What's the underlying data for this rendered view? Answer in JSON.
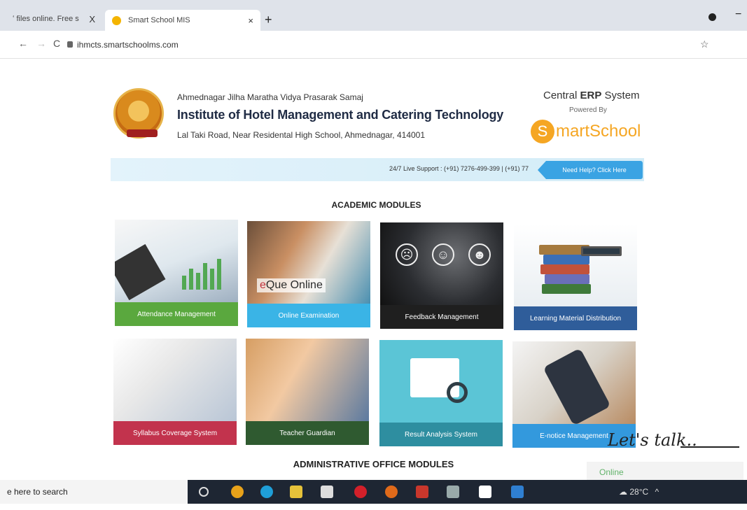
{
  "browser": {
    "tabs": [
      {
        "label": "ʻ files online. Free s",
        "close": "X"
      },
      {
        "label": "Smart School MIS",
        "close": "×"
      }
    ],
    "new_tab": "+",
    "url": "ihmcts.smartschoolms.com",
    "star": "☆"
  },
  "header": {
    "org": "Ahmednagar Jilha Maratha Vidya Prasarak Samaj",
    "institute": "Institute of Hotel Management and Catering Technology",
    "address": "Lal Taki Road, Near Residental High School, Ahmednagar, 414001",
    "erp_prefix": "Central ",
    "erp_bold": "ERP",
    "erp_suffix": " System",
    "powered_by": "Powered By",
    "brand_s": "S",
    "brand_rest": "martSchool"
  },
  "support": {
    "text": "24/7 Live Support : (+91) 7276-499-399 | (+91) 77",
    "help": "Need Help? Click Here"
  },
  "sections": {
    "academic": "ACADEMIC MODULES",
    "admin": "ADMINISTRATIVE OFFICE MODULES"
  },
  "modules": [
    {
      "label": "Attendance Management",
      "color": "#5aa83e"
    },
    {
      "label": "Online Examination",
      "color": "#3ab4e6"
    },
    {
      "label": "Feedback Management",
      "color": "#1f1f1f"
    },
    {
      "label": "Learning Material Distribution",
      "color": "#2f5d9a"
    },
    {
      "label": "Syllabus Coverage System",
      "color": "#c2334d"
    },
    {
      "label": "Teacher Guardian",
      "color": "#2f5a30"
    },
    {
      "label": "Result Analysis System",
      "color": "#2e8ea0"
    },
    {
      "label": "E-notice Management",
      "color": "#3399dd"
    }
  ],
  "eque": {
    "e": "e",
    "rest": "Que Online"
  },
  "chat": {
    "lets_talk": "Let's talk..",
    "status": "Online"
  },
  "taskbar": {
    "search": "e here to search",
    "tray_temp": "28°C",
    "tray_arrow": "^"
  }
}
